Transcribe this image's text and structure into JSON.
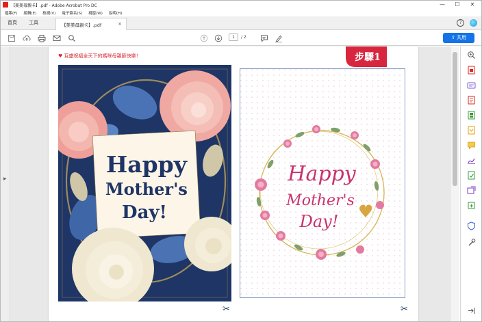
{
  "window": {
    "title": "【美美母親卡】.pdf - Adobe Acrobat Pro DC",
    "minimize": "—",
    "maximize": "☐",
    "close": "✕"
  },
  "menu": [
    "檔案(F)",
    "編輯(E)",
    "檢視(V)",
    "電子簽名(S)",
    "視窗(W)",
    "說明(H)"
  ],
  "tabs": {
    "home": "首頁",
    "tools": "工具",
    "document": "【美美母親卡】.pdf",
    "close": "×",
    "help": "?"
  },
  "toolbar": {
    "page_current": "1",
    "page_total": "/ 2",
    "share_label": "共用"
  },
  "document": {
    "greeting": "♥ 互盛祝福全天下的媽咪母親節快樂！",
    "step_badge": "步驟1",
    "card_left": {
      "line1": "Happy",
      "line2": "Mother's",
      "line3": "Day!"
    },
    "card_right": {
      "line1": "Happy",
      "line2": "Mother's",
      "line3": "Day!"
    },
    "scissors": "✂"
  },
  "colors": {
    "accent_blue": "#1473e6",
    "navy": "#1e3566",
    "badge_red": "#d7263d",
    "pink_text": "#c9336d",
    "cream": "#fdf6e8"
  },
  "icons": {
    "toolbar": [
      "save-icon",
      "upload-icon",
      "print-icon",
      "email-icon",
      "search-icon",
      "prev-page-icon",
      "next-page-icon",
      "comment-icon",
      "sign-icon"
    ],
    "right": [
      "zoom-icon",
      "export-pdf-icon",
      "create-pdf-icon",
      "edit-pdf-icon",
      "organize-pages-icon",
      "combine-files-icon",
      "comment-tool-icon",
      "fill-sign-icon",
      "protect-icon",
      "send-track-icon",
      "stamp-icon",
      "tools-icon",
      "expand-icon"
    ]
  }
}
